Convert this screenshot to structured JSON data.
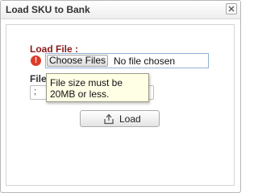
{
  "dialog": {
    "title": "Load SKU to Bank",
    "close_icon": "close-icon"
  },
  "form": {
    "load_file_label": "Load File :",
    "error_icon": "exclamation-icon",
    "choose_files_label": "Choose Files",
    "file_status": "No file chosen",
    "file_type_label": "File",
    "separator_value": ";",
    "tooltip_text": "File size must be 20MB or less.",
    "load_button_label": "Load",
    "load_icon": "upload-icon"
  },
  "colors": {
    "label_red": "#8b1a1a",
    "error_red": "#dd3b2a",
    "tooltip_bg": "#ffffe6",
    "input_border": "#8fb0d6"
  }
}
